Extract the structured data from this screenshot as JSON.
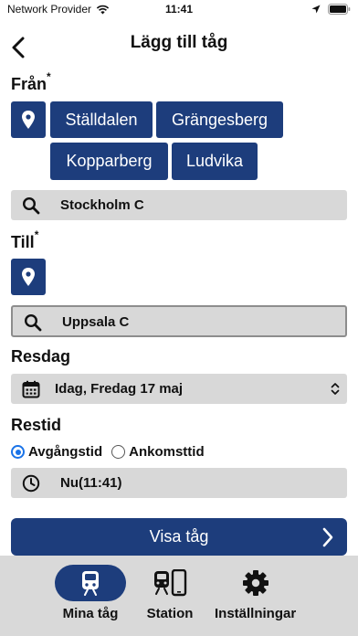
{
  "status_bar": {
    "carrier": "Network Provider",
    "time": "11:41"
  },
  "header": {
    "title": "Lägg till tåg"
  },
  "from": {
    "label": "Från",
    "required_mark": "*",
    "chips": [
      "Ställdalen",
      "Grängesberg",
      "Kopparberg",
      "Ludvika"
    ],
    "search_value": "Stockholm C"
  },
  "to": {
    "label": "Till",
    "required_mark": "*",
    "search_value": "Uppsala C"
  },
  "travel_day": {
    "label": "Resdag",
    "selected": "Idag, Fredag 17 maj"
  },
  "travel_time": {
    "label": "Restid",
    "options": [
      "Avgångstid",
      "Ankomsttid"
    ],
    "selected_option": "Avgångstid",
    "value": "Nu(11:41)"
  },
  "primary_button": {
    "label": "Visa tåg"
  },
  "tabs": [
    {
      "label": "Mina tåg",
      "icon": "train-icon",
      "active": true
    },
    {
      "label": "Station",
      "icon": "station-icon",
      "active": false
    },
    {
      "label": "Inställningar",
      "icon": "gear-icon",
      "active": false
    }
  ],
  "colors": {
    "primary": "#1d3d7c",
    "field_bg": "#d8d8d8",
    "tabbar_bg": "#d9d9d9",
    "radio_accent": "#1a73e8"
  }
}
